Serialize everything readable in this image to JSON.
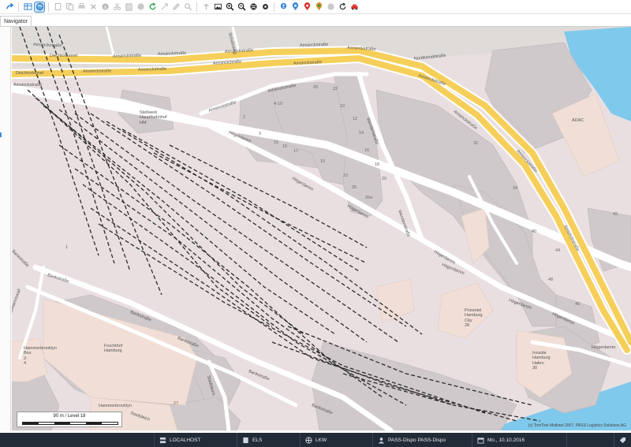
{
  "toolbar": {
    "buttons": [
      "redo-icon",
      "table-icon",
      "map-view-icon",
      "new-document-icon",
      "copy-icon",
      "print-icon",
      "delete-icon",
      "info-icon",
      "cut-icon",
      "paste-icon",
      "record-icon",
      "refresh-icon",
      "expand-icon",
      "edit-icon",
      "search-icon",
      "upload-icon",
      "image-icon",
      "zoom-in-icon",
      "zoom-out-icon",
      "globe-icon",
      "settings-icon",
      "user-pin-icon",
      "route-pin-icon",
      "red-pin-icon",
      "orange-pin-icon",
      "grey-pin-icon",
      "reload-icon",
      "car-icon"
    ]
  },
  "tab": {
    "label": "Navigator"
  },
  "map": {
    "streets": {
      "amsinck1": "Amsinckstraße",
      "amsinck2": "Amsinckstraße",
      "amsinck3": "Amsinckstraße",
      "amsinck4": "Amsinckstraße",
      "amsinck5": "Amsinckstraße",
      "amsinck6": "Amsinckstraße",
      "amsinck7": "Amsinckstraße",
      "amsinck8": "Amsinckstraße",
      "amsinck9": "Amsinckstraße",
      "amsinck10": "Amsinckstraße",
      "amsinck11": "Amsinckstraße",
      "amsinck12": "Amsinckstraße",
      "amsinck13": "Amsinckstraße",
      "amsinck14": "Amsinckstraße",
      "deich1": "Deichtortunnel",
      "deich2": "Deichtortunnel",
      "nordkanal": "Nordkanalstraße",
      "hoegerdamm1": "Högerdamm",
      "hoegerdamm2": "Högerdamm",
      "hoegerdamm3": "Högerdamm",
      "hoegerdamm4": "Högerdamm",
      "hoegerdamm5": "Högerdamm",
      "hoegerdamm6": "Högerdamm",
      "hoegerdamm7": "Högerdamm",
      "hoegerdamm8": "Högerdamm",
      "wendenstr1": "Wendenstraße",
      "wendenstr2": "Wendenstraße",
      "bankstr1": "Bankstraße",
      "bankstr2": "Bankstraße",
      "bankstr3": "Bankstraße",
      "bankstr4": "Bankstraße",
      "bankstr5": "Bankstraße",
      "stadtdeich1": "Stadtdeich",
      "stadtdeich2": "Stadtdeich",
      "johannis": "Johanniswall",
      "schultzweg": "Schultzweg",
      "banks_l": "Bankstraße"
    },
    "pois": {
      "stellwerk": [
        "Stellwerk",
        "Hauptbahnhof",
        "Hhf"
      ],
      "adac": "ADAC",
      "prizeotel": [
        "Prizeotel",
        "Hamburg",
        "City",
        "28"
      ],
      "innside": [
        "Innside",
        "Hamburg",
        "Hafen",
        "30"
      ],
      "fruchthof": [
        "Fruchthof",
        "Hamburg"
      ],
      "hammerbrook_box": [
        "Hammerbrooklyn",
        "Box",
        "2-",
        "4"
      ],
      "hammerbrooklyn": "Hammerbrooklyn"
    },
    "house_numbers": [
      "4-10",
      "2",
      "3",
      "15",
      "16",
      "17",
      "20",
      "22",
      "10",
      "12",
      "14",
      "16",
      "18",
      "20",
      "19",
      "23",
      "25",
      "26a",
      "32",
      "34",
      "40",
      "44",
      "48",
      "46",
      "43",
      "27",
      "1"
    ],
    "scale": {
      "label": "90 m / Level 18"
    },
    "attribution": "(c) TomTom Multinet 2007, PASS Logistics Solutions AG",
    "colors": {
      "land": "#e9dfe1",
      "water": "#7fc9ec",
      "motorway": "#f6cf5a",
      "building": "#cfc9cb"
    }
  },
  "taskbar": {
    "localhost": "LOCALHOST",
    "els": "ELS",
    "lkw": "LKW",
    "pass": "PASS-Dispo PASS-Dispo",
    "date": "Mo., 10.10.2016"
  }
}
